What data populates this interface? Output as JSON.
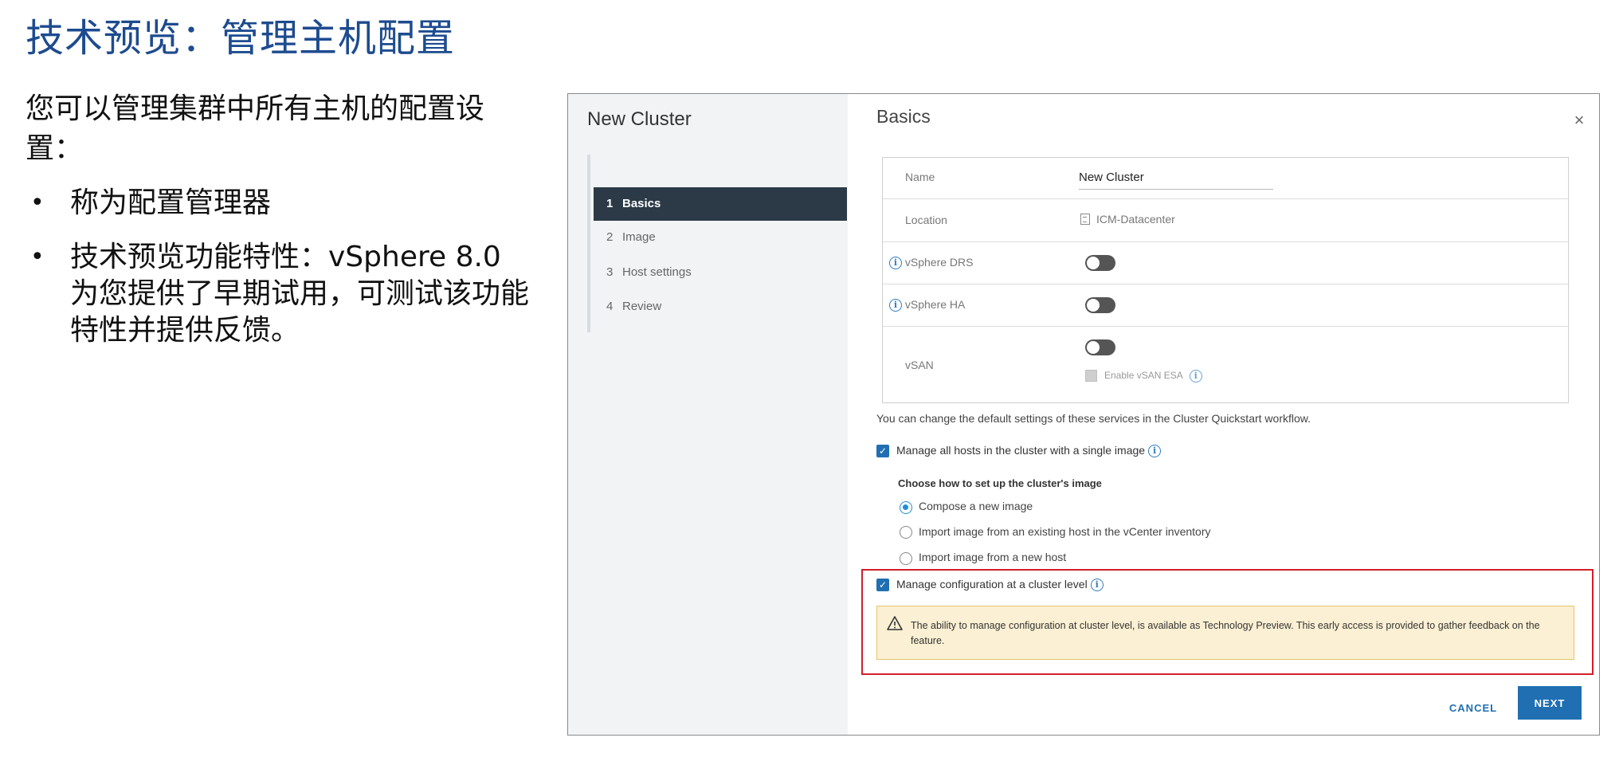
{
  "slide": {
    "title": "技术预览：管理主机配置",
    "intro": "您可以管理集群中所有主机的配置设置：",
    "bullets": [
      "称为配置管理器",
      "技术预览功能特性：vSphere 8.0 为您提供了早期试用，可测试该功能特性并提供反馈。"
    ],
    "bullet_symbol": "•"
  },
  "dialog": {
    "title": "New Cluster",
    "heading": "Basics",
    "close_glyph": "×",
    "steps": [
      {
        "num": "1",
        "label": "Basics",
        "active": true
      },
      {
        "num": "2",
        "label": "Image",
        "active": false
      },
      {
        "num": "3",
        "label": "Host settings",
        "active": false
      },
      {
        "num": "4",
        "label": "Review",
        "active": false
      }
    ],
    "form": {
      "name_label": "Name",
      "name_value": "New Cluster",
      "location_label": "Location",
      "location_value": "ICM-Datacenter",
      "drs_label": "vSphere DRS",
      "drs_on": false,
      "ha_label": "vSphere HA",
      "ha_on": false,
      "vsan_label": "vSAN",
      "vsan_on": false,
      "vsan_esa_label": "Enable vSAN ESA"
    },
    "note": "You can change the default settings of these services in the Cluster Quickstart workflow.",
    "single_image_label": "Manage all hosts in the cluster with a single image",
    "single_image_checked": true,
    "image_setup_heading": "Choose how to set up the cluster's image",
    "image_options": [
      {
        "label": "Compose a new image",
        "selected": true
      },
      {
        "label": "Import image from an existing host in the vCenter inventory",
        "selected": false
      },
      {
        "label": "Import image from a new host",
        "selected": false
      }
    ],
    "cluster_config_label": "Manage configuration at a cluster level",
    "cluster_config_checked": true,
    "warning_text": "The ability to manage configuration at cluster level, is available as Technology Preview. This early access is provided to gather feedback on the feature.",
    "cancel_label": "CANCEL",
    "next_label": "NEXT"
  },
  "colors": {
    "title_blue": "#1d4b8f",
    "accent_blue": "#1f6fb2",
    "active_step_bg": "#2b3a46",
    "highlight_red": "#d31f2a",
    "warning_bg": "#fbf0d3"
  }
}
